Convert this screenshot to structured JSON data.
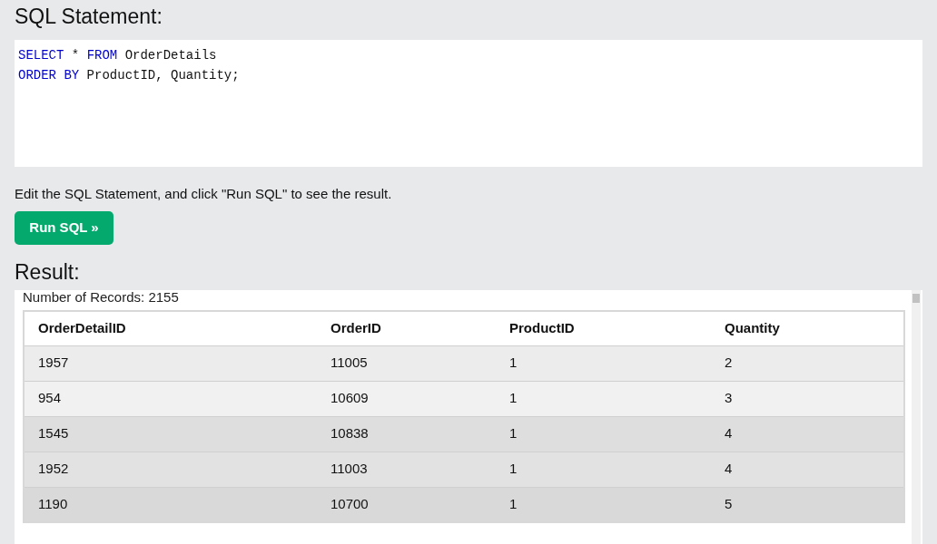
{
  "editor": {
    "heading": "SQL Statement:",
    "code_lines": [
      [
        {
          "text": "SELECT",
          "kind": "keyword"
        },
        {
          "text": " * ",
          "kind": "plain"
        },
        {
          "text": "FROM",
          "kind": "keyword"
        },
        {
          "text": " OrderDetails",
          "kind": "plain"
        }
      ],
      [
        {
          "text": "ORDER BY",
          "kind": "keyword"
        },
        {
          "text": " ProductID, Quantity;",
          "kind": "plain"
        }
      ]
    ],
    "hint": "Edit the SQL Statement, and click \"Run SQL\" to see the result.",
    "run_button": "Run SQL »"
  },
  "result": {
    "heading": "Result:",
    "record_count": "Number of Records: 2155",
    "table": {
      "columns": [
        "OrderDetailID",
        "OrderID",
        "ProductID",
        "Quantity"
      ],
      "rows": [
        [
          "1957",
          "11005",
          "1",
          "2"
        ],
        [
          "954",
          "10609",
          "1",
          "3"
        ],
        [
          "1545",
          "10838",
          "1",
          "4"
        ],
        [
          "1952",
          "11003",
          "1",
          "4"
        ],
        [
          "1190",
          "10700",
          "1",
          "5"
        ]
      ]
    }
  }
}
